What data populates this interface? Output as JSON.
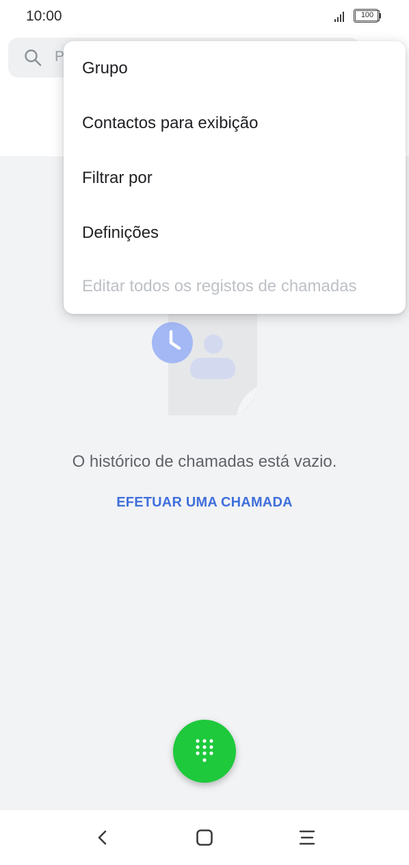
{
  "status_bar": {
    "time": "10:00",
    "battery": "100",
    "signal_icon": "signal-bars-icon",
    "battery_icon": "battery-icon"
  },
  "search": {
    "icon": "search-icon",
    "placeholder_visible": "P"
  },
  "menu": {
    "items": [
      {
        "label": "Grupo",
        "enabled": true
      },
      {
        "label": "Contactos para exibição",
        "enabled": true
      },
      {
        "label": "Filtrar por",
        "enabled": true
      },
      {
        "label": "Definições",
        "enabled": true
      },
      {
        "label": "Editar todos os registos de chamadas",
        "enabled": false
      }
    ]
  },
  "empty_state": {
    "illustration_icon": "call-history-illustration-icon",
    "message": "O histórico de chamadas está vazio.",
    "action_label": "EFETUAR UMA CHAMADA"
  },
  "fab": {
    "icon": "dialpad-icon",
    "color": "#1ec93c"
  },
  "nav_bar": {
    "back_icon": "back-icon",
    "home_icon": "home-icon",
    "menu_icon": "recents-menu-icon"
  },
  "colors": {
    "accent": "#3f6fdb",
    "background": "#f2f3f5",
    "disabled_text": "#bdc1c6"
  }
}
